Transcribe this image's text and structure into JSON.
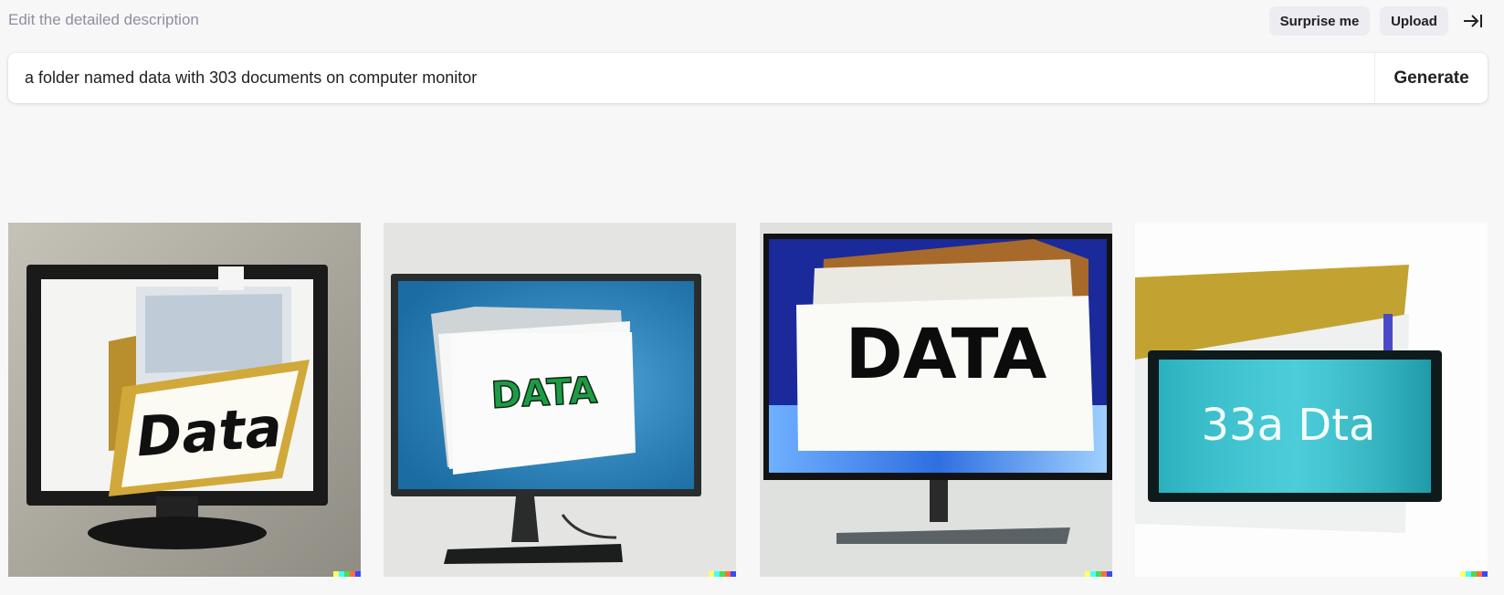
{
  "header": {
    "hint": "Edit the detailed description",
    "surprise_label": "Surprise me",
    "upload_label": "Upload",
    "collapse_icon": "arrow-right-to-bar-icon"
  },
  "prompt": {
    "value": "a folder named data with 303 documents on computer monitor",
    "generate_label": "Generate"
  },
  "results": [
    {
      "label": "Data"
    },
    {
      "label": "DATA"
    },
    {
      "label": "DATA"
    },
    {
      "label": "33a Dta"
    }
  ],
  "colors": {
    "signature": [
      "#ffff66",
      "#42ffff",
      "#51da4c",
      "#ff6e3c",
      "#3c46ff"
    ]
  }
}
